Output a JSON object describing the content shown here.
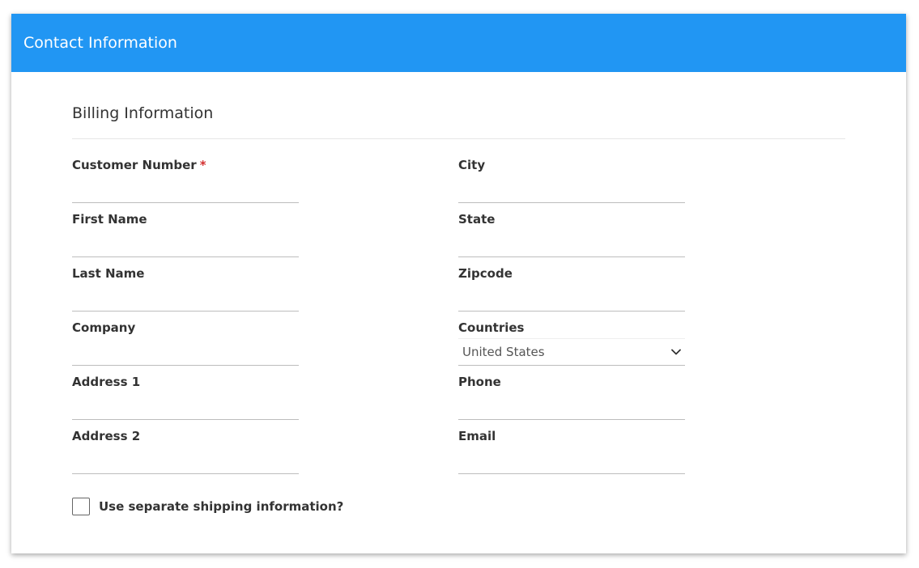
{
  "header": {
    "title": "Contact Information"
  },
  "section": {
    "title": "Billing Information"
  },
  "left_fields": [
    {
      "label": "Customer Number",
      "required_mark": "*",
      "value": ""
    },
    {
      "label": "First Name",
      "value": ""
    },
    {
      "label": "Last Name",
      "value": ""
    },
    {
      "label": "Company",
      "value": ""
    },
    {
      "label": "Address 1",
      "value": ""
    },
    {
      "label": "Address 2",
      "value": ""
    }
  ],
  "right_fields": [
    {
      "label": "City",
      "value": ""
    },
    {
      "label": "State",
      "value": ""
    },
    {
      "label": "Zipcode",
      "value": ""
    },
    {
      "label": "Countries",
      "selected": "United States"
    },
    {
      "label": "Phone",
      "value": ""
    },
    {
      "label": "Email",
      "value": ""
    }
  ],
  "shipping_checkbox": {
    "label": "Use separate shipping information?",
    "checked": false
  },
  "colors": {
    "header_bg": "#2196f3",
    "required": "#d32f2f"
  },
  "icons": {
    "select_toggle": "chevron-down-icon"
  }
}
